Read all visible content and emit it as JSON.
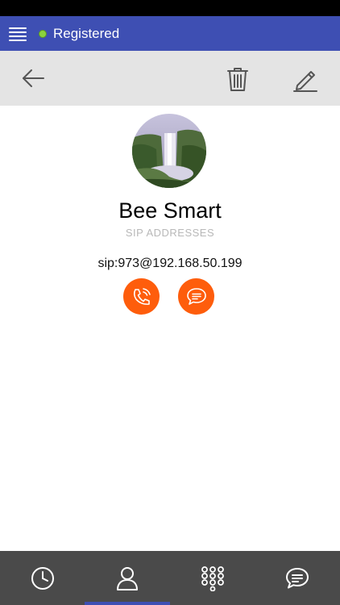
{
  "topbar": {
    "status_text": "Registered",
    "status_color": "#8bd23d",
    "color": "#3e4fb3"
  },
  "toolbar": {
    "icons": [
      "back-arrow-icon",
      "trash-icon",
      "pencil-icon"
    ]
  },
  "contact": {
    "name": "Bee Smart",
    "section_label": "SIP ADDRESSES",
    "sip_address": "sip:973@192.168.50.199"
  },
  "actions": {
    "accent": "#fe5d0c",
    "icons": [
      "phone-icon",
      "chat-bubble-icon"
    ]
  },
  "bottom_nav": {
    "items": [
      "history-clock-icon",
      "contacts-person-icon",
      "dialpad-icon",
      "chat-icon"
    ],
    "active_item": "contacts-person-icon"
  }
}
